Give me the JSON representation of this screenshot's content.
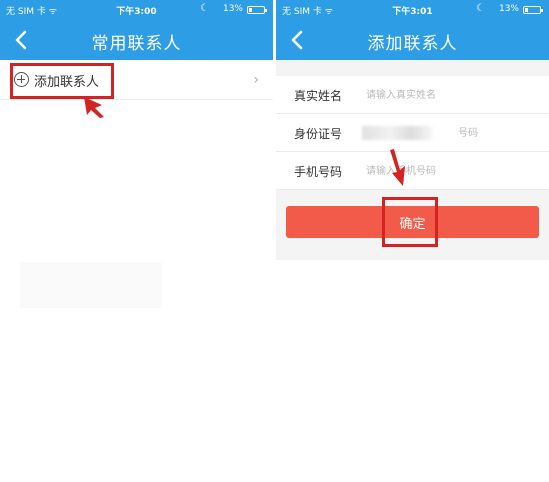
{
  "left_screen": {
    "status": {
      "carrier": "无 SIM 卡 ᯤ",
      "time": "下午3:00",
      "battery": "13%"
    },
    "nav": {
      "title": "常用联系人"
    },
    "add_contact_label": "添加联系人"
  },
  "right_screen": {
    "status": {
      "carrier": "无 SIM 卡 ᯤ",
      "time": "下午3:01",
      "battery": "13%"
    },
    "nav": {
      "title": "添加联系人"
    },
    "form": {
      "name_label": "真实姓名",
      "name_placeholder": "请输入真实姓名",
      "id_label": "身份证号",
      "id_placeholder": "号码",
      "phone_label": "手机号码",
      "phone_placeholder": "请输入手机号码"
    },
    "confirm_label": "确定"
  },
  "colors": {
    "primary": "#2d9de5",
    "confirm": "#f25a4a",
    "highlight": "#d32323"
  },
  "icons": [
    "back-arrow-icon",
    "plus-circle-icon",
    "chevron-right-icon",
    "moon-icon",
    "battery-icon",
    "red-pointer-arrow-icon"
  ]
}
